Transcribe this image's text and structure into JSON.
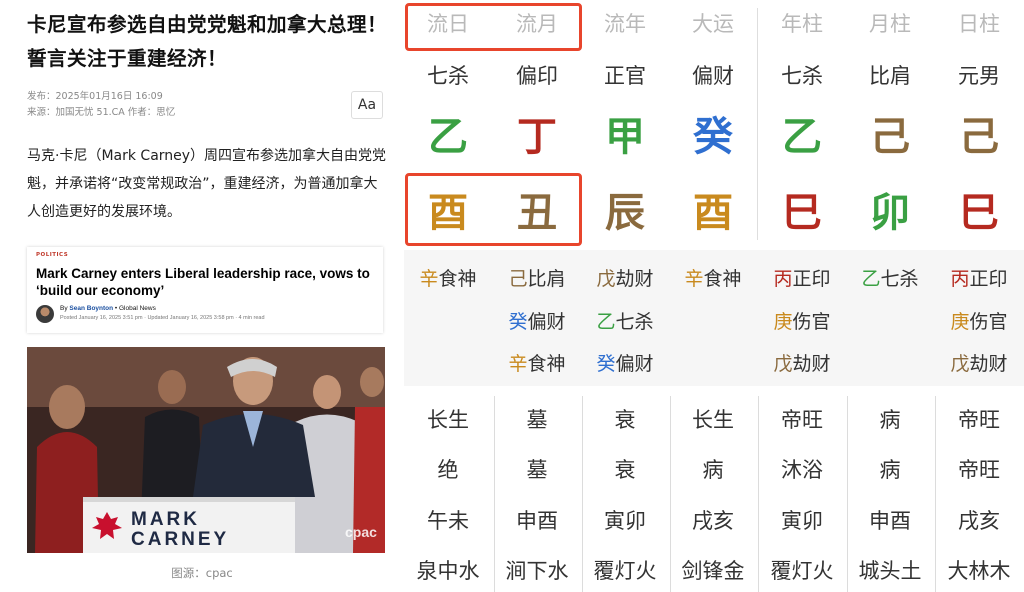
{
  "article": {
    "headline": "卡尼宣布参选自由党党魁和加拿大总理！誓言关注于重建经济！",
    "meta_published": "发布：2025年01月16日 16:09",
    "meta_source": "来源：加国无忧 51.CA   作者：思忆",
    "font_button": "Aa",
    "body": "马克·卡尼（Mark Carney）周四宣布参选加拿大自由党党魁，并承诺将“改变常规政治”，重建经济，为普通加拿大人创造更好的发展环境。",
    "card": {
      "tag": "POLITICS",
      "title": "Mark Carney enters Liberal leadership race, vows to ‘build our economy’",
      "by_prefix": "By ",
      "author": "Sean Boynton",
      "outlet": " • Global News",
      "posted": "Posted January 16, 2025 3:51 pm · Updated January 16, 2025 3:58 pm · 4 min read"
    },
    "photo": {
      "sign_line1": "MARK",
      "sign_line2": "CARNEY",
      "watermark": "cpac"
    },
    "caption": "图源：cpac"
  },
  "bazi": {
    "headers": [
      "流日",
      "流月",
      "流年",
      "大运",
      "年柱",
      "月柱",
      "日柱"
    ],
    "roles": [
      "七杀",
      "偏印",
      "正官",
      "偏财",
      "七杀",
      "比肩",
      "元男"
    ],
    "stems": [
      "乙",
      "丁",
      "甲",
      "癸",
      "乙",
      "己",
      "己"
    ],
    "branches": [
      "酉",
      "丑",
      "辰",
      "酉",
      "巳",
      "卯",
      "巳"
    ],
    "colors": {
      "wood": "#3aa043",
      "fire": "#b52a20",
      "earth": "#8a6a3e",
      "metal": "#c98a1e",
      "water": "#2f6fd0",
      "header": "#b9b9b9",
      "highlight": "#e8452c"
    },
    "stem_elements": [
      "wood",
      "fire",
      "wood",
      "water",
      "wood",
      "earth",
      "earth"
    ],
    "branch_elements": [
      "metal",
      "earth",
      "earth",
      "metal",
      "fire",
      "wood",
      "fire"
    ],
    "hidden": [
      [
        {
          "g": "辛",
          "e": "metal",
          "t": "食神"
        }
      ],
      [
        {
          "g": "己",
          "e": "earth",
          "t": "比肩"
        },
        {
          "g": "癸",
          "e": "water",
          "t": "偏财"
        },
        {
          "g": "辛",
          "e": "metal",
          "t": "食神"
        }
      ],
      [
        {
          "g": "戊",
          "e": "earth",
          "t": "劫财"
        },
        {
          "g": "乙",
          "e": "wood",
          "t": "七杀"
        },
        {
          "g": "癸",
          "e": "water",
          "t": "偏财"
        }
      ],
      [
        {
          "g": "辛",
          "e": "metal",
          "t": "食神"
        }
      ],
      [
        {
          "g": "丙",
          "e": "fire",
          "t": "正印"
        },
        {
          "g": "庚",
          "e": "metal",
          "t": "伤官"
        },
        {
          "g": "戊",
          "e": "earth",
          "t": "劫财"
        }
      ],
      [
        {
          "g": "乙",
          "e": "wood",
          "t": "七杀"
        }
      ],
      [
        {
          "g": "丙",
          "e": "fire",
          "t": "正印"
        },
        {
          "g": "庚",
          "e": "metal",
          "t": "伤官"
        },
        {
          "g": "戊",
          "e": "earth",
          "t": "劫财"
        }
      ]
    ],
    "stage1": [
      "长生",
      "墓",
      "衰",
      "长生",
      "帝旺",
      "病",
      "帝旺"
    ],
    "stage2": [
      "绝",
      "墓",
      "衰",
      "病",
      "沐浴",
      "病",
      "帝旺"
    ],
    "kongwang": [
      "午未",
      "申酉",
      "寅卯",
      "戌亥",
      "寅卯",
      "申酉",
      "戌亥"
    ],
    "nayin": [
      "泉中水",
      "涧下水",
      "覆灯火",
      "剑锋金",
      "覆灯火",
      "城头土",
      "大林木"
    ]
  }
}
